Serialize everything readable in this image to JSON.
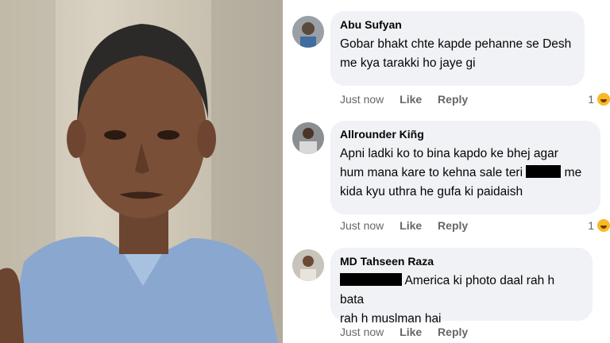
{
  "photo": {
    "subject_icon": "person-photo"
  },
  "comments": [
    {
      "name": "Abu Sufyan",
      "lines": [
        "Gobar bhakt chte kapde pehanne se Desh",
        "me kya tarakki ho jaye gi"
      ],
      "time": "Just now",
      "like": "Like",
      "reply": "Reply",
      "reaction_count": "1",
      "reaction_icon": "haha-icon"
    },
    {
      "name": "Allrounder Kiñg",
      "line1": "Apni ladki ko to bina kapdo ke bhej agar",
      "line2_before": "hum mana kare to kehna sale teri",
      "line2_after": "me",
      "line3": "kida kyu uthra he gufa ki paidaish",
      "time": "Just now",
      "like": "Like",
      "reply": "Reply",
      "reaction_count": "1",
      "reaction_icon": "haha-icon"
    },
    {
      "name": "MD Tahseen Raza",
      "line1_after": "America ki photo daal rah h bata",
      "line2": "rah h muslman hai",
      "time": "Just now",
      "like": "Like",
      "reply": "Reply"
    }
  ],
  "colors": {
    "bubble": "#f0f2f5",
    "meta_text": "#65676b",
    "reaction": "#f7b928"
  }
}
